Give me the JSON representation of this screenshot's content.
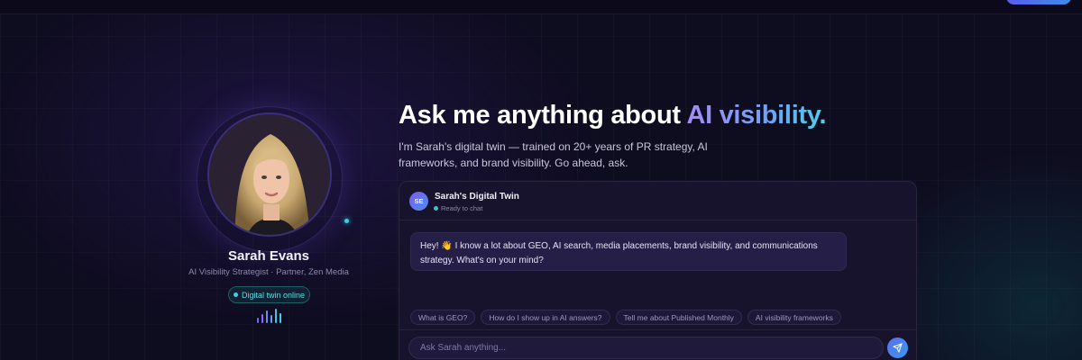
{
  "profile": {
    "name": "Sarah Evans",
    "role": "AI Visibility Strategist · Partner, Zen Media",
    "status_badge": "Digital twin online"
  },
  "hero": {
    "headline_prefix": "Ask me anything about ",
    "headline_accent": "AI visibility.",
    "subtext": "I'm Sarah's digital twin — trained on 20+ years of PR strategy, AI frameworks, and brand visibility. Go ahead, ask."
  },
  "chat": {
    "avatar_initials": "SE",
    "title": "Sarah's Digital Twin",
    "status": "Ready to chat",
    "messages": [
      {
        "from": "assistant",
        "text": "Hey! 👋 I know a lot about GEO, AI search, media placements, brand visibility, and communications strategy. What's on your mind?"
      }
    ],
    "suggestions": [
      "What is GEO?",
      "How do I show up in AI answers?",
      "Tell me about Published Monthly",
      "AI visibility frameworks"
    ],
    "input_placeholder": "Ask Sarah anything...",
    "input_value": ""
  },
  "colors": {
    "accent_cyan": "#2fd3e0",
    "accent_purple": "#a58bf5",
    "background": "#0e0c1f"
  },
  "icons": {
    "send": "paper-plane-icon",
    "wave": "voice-waveform-icon"
  }
}
